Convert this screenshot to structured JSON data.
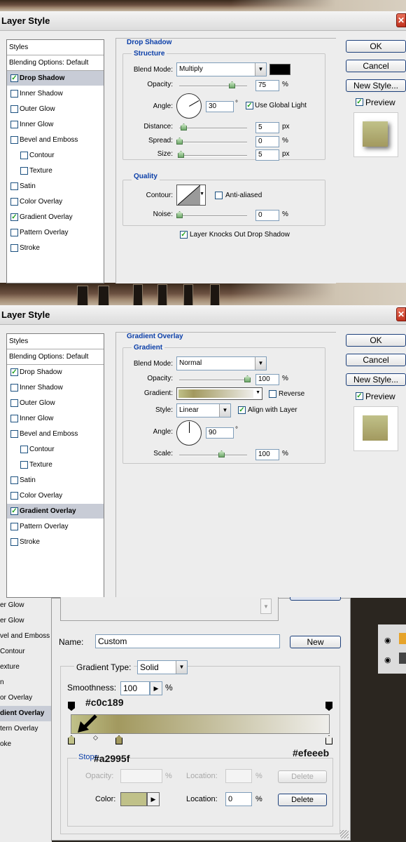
{
  "dialog1": {
    "title": "Layer Style",
    "styles_header": "Styles",
    "blending_options": "Blending Options: Default",
    "items": [
      {
        "label": "Drop Shadow",
        "checked": true,
        "selected": true,
        "sub": false
      },
      {
        "label": "Inner Shadow",
        "checked": false,
        "selected": false,
        "sub": false
      },
      {
        "label": "Outer Glow",
        "checked": false,
        "selected": false,
        "sub": false
      },
      {
        "label": "Inner Glow",
        "checked": false,
        "selected": false,
        "sub": false
      },
      {
        "label": "Bevel and Emboss",
        "checked": false,
        "selected": false,
        "sub": false
      },
      {
        "label": "Contour",
        "checked": false,
        "selected": false,
        "sub": true
      },
      {
        "label": "Texture",
        "checked": false,
        "selected": false,
        "sub": true
      },
      {
        "label": "Satin",
        "checked": false,
        "selected": false,
        "sub": false
      },
      {
        "label": "Color Overlay",
        "checked": false,
        "selected": false,
        "sub": false
      },
      {
        "label": "Gradient Overlay",
        "checked": true,
        "selected": false,
        "sub": false
      },
      {
        "label": "Pattern Overlay",
        "checked": false,
        "selected": false,
        "sub": false
      },
      {
        "label": "Stroke",
        "checked": false,
        "selected": false,
        "sub": false
      }
    ],
    "section_title": "Drop Shadow",
    "structure": {
      "title": "Structure",
      "blend_mode_label": "Blend Mode:",
      "blend_mode": "Multiply",
      "shadow_color": "#000000",
      "opacity_label": "Opacity:",
      "opacity": "75",
      "opacity_level": 0.75,
      "angle_label": "Angle:",
      "angle": "30",
      "angle_unit": "°",
      "use_global_light": "Use Global Light",
      "distance_label": "Distance:",
      "distance": "5",
      "distance_level": 0.05,
      "spread_label": "Spread:",
      "spread": "0",
      "spread_level": 0,
      "size_label": "Size:",
      "size": "5",
      "size_level": 0.02,
      "px": "px",
      "pct": "%"
    },
    "quality": {
      "title": "Quality",
      "contour_label": "Contour:",
      "anti_aliased": "Anti-aliased",
      "noise_label": "Noise:",
      "noise": "0",
      "noise_level": 0
    },
    "knocks_out": "Layer Knocks Out Drop Shadow",
    "buttons": {
      "ok": "OK",
      "cancel": "Cancel",
      "new_style": "New Style..."
    },
    "preview_label": "Preview"
  },
  "dialog2": {
    "title": "Layer Style",
    "styles_header": "Styles",
    "blending_options": "Blending Options: Default",
    "items": [
      {
        "label": "Drop Shadow",
        "checked": true,
        "selected": false,
        "sub": false
      },
      {
        "label": "Inner Shadow",
        "checked": false,
        "selected": false,
        "sub": false
      },
      {
        "label": "Outer Glow",
        "checked": false,
        "selected": false,
        "sub": false
      },
      {
        "label": "Inner Glow",
        "checked": false,
        "selected": false,
        "sub": false
      },
      {
        "label": "Bevel and Emboss",
        "checked": false,
        "selected": false,
        "sub": false
      },
      {
        "label": "Contour",
        "checked": false,
        "selected": false,
        "sub": true
      },
      {
        "label": "Texture",
        "checked": false,
        "selected": false,
        "sub": true
      },
      {
        "label": "Satin",
        "checked": false,
        "selected": false,
        "sub": false
      },
      {
        "label": "Color Overlay",
        "checked": false,
        "selected": false,
        "sub": false
      },
      {
        "label": "Gradient Overlay",
        "checked": true,
        "selected": true,
        "sub": false
      },
      {
        "label": "Pattern Overlay",
        "checked": false,
        "selected": false,
        "sub": false
      },
      {
        "label": "Stroke",
        "checked": false,
        "selected": false,
        "sub": false
      }
    ],
    "section_title": "Gradient Overlay",
    "gradient": {
      "title": "Gradient",
      "blend_mode_label": "Blend Mode:",
      "blend_mode": "Normal",
      "opacity_label": "Opacity:",
      "opacity": "100",
      "opacity_level": 1,
      "gradient_label": "Gradient:",
      "reverse": "Reverse",
      "style_label": "Style:",
      "style": "Linear",
      "align_with_layer": "Align with Layer",
      "angle_label": "Angle:",
      "angle": "90",
      "angle_unit": "°",
      "scale_label": "Scale:",
      "scale": "100",
      "scale_level": 0.6,
      "pct": "%"
    },
    "buttons": {
      "ok": "OK",
      "cancel": "Cancel",
      "new_style": "New Style..."
    },
    "preview_label": "Preview"
  },
  "editor": {
    "left_items": [
      {
        "label": "er Glow",
        "selected": false
      },
      {
        "label": "er Glow",
        "selected": false
      },
      {
        "label": "vel and Emboss",
        "selected": false
      },
      {
        "label": "Contour",
        "selected": false
      },
      {
        "label": "exture",
        "selected": false
      },
      {
        "label": "n",
        "selected": false
      },
      {
        "label": "or Overlay",
        "selected": false
      },
      {
        "label": "dient Overlay",
        "selected": true
      },
      {
        "label": "tern Overlay",
        "selected": false
      },
      {
        "label": "oke",
        "selected": false
      }
    ],
    "name_label": "Name:",
    "name_value": "Custom",
    "new_button": "New",
    "gradient_type_label": "Gradient Type:",
    "gradient_type": "Solid",
    "smoothness_label": "Smoothness:",
    "smoothness": "100",
    "pct": "%",
    "colors": {
      "start": "#c0c189",
      "mid": "#a2995f",
      "end": "#efeeeb"
    },
    "annotations": {
      "top": "#c0c189",
      "mid": "#a2995f",
      "end": "#efeeeb"
    },
    "stops_title": "Stops",
    "opacity_label": "Opacity:",
    "location_label": "Location:",
    "delete_label": "Delete",
    "color_label": "Color:",
    "color_location": "0",
    "stop_color": "#c0c189"
  }
}
